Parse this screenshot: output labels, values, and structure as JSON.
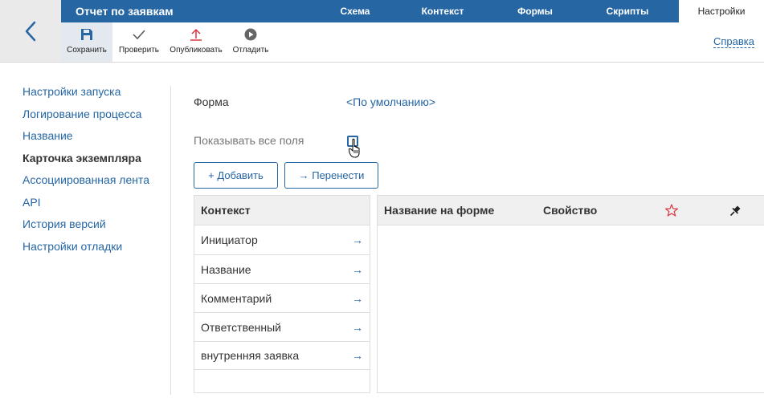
{
  "header": {
    "title": "Отчет по заявкам",
    "tabs": [
      {
        "label": "Схема"
      },
      {
        "label": "Контекст"
      },
      {
        "label": "Формы"
      },
      {
        "label": "Скрипты"
      },
      {
        "label": "Настройки",
        "active": true
      }
    ]
  },
  "toolbar": {
    "save_label": "Сохранить",
    "check_label": "Проверить",
    "publish_label": "Опубликовать",
    "debug_label": "Отладить",
    "help_label": "Справка"
  },
  "sidebar": {
    "items": [
      {
        "label": "Настройки запуска"
      },
      {
        "label": "Логирование процесса"
      },
      {
        "label": "Название"
      },
      {
        "label": "Карточка экземпляра",
        "active": true
      },
      {
        "label": "Ассоциированная лента"
      },
      {
        "label": "API"
      },
      {
        "label": "История версий"
      },
      {
        "label": "Настройки отладки"
      }
    ]
  },
  "main": {
    "form_label": "Форма",
    "form_value": "<По умолчанию>",
    "show_all_label": "Показывать все поля",
    "show_all_checked": false,
    "add_button": "+ Добавить",
    "move_button": "→ Перенести",
    "context_panel": {
      "header": "Контекст",
      "rows": [
        "Инициатор",
        "Название",
        "Комментарий",
        "Ответственный",
        "внутренняя заявка"
      ],
      "row_arrow": "→"
    },
    "fields_panel": {
      "col_name": "Название на форме",
      "col_property": "Свойство"
    }
  },
  "colors": {
    "accent": "#2566a3",
    "star": "#d9363e",
    "header_bg": "#f0f0f0"
  },
  "icons": [
    "chevron-left-icon",
    "save-icon",
    "check-icon",
    "publish-icon",
    "debug-play-icon",
    "star-icon",
    "pin-icon",
    "hand-cursor-icon"
  ]
}
